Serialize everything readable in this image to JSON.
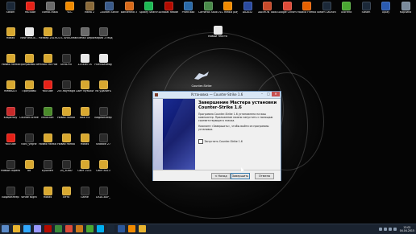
{
  "desktop": {
    "icons": [
      {
        "label": "Steam",
        "color": "#1b2838"
      },
      {
        "label": "YouTube",
        "color": "#e62117"
      },
      {
        "label": "combi-rasta",
        "color": "#6a6a6a"
      },
      {
        "label": "VLC",
        "color": "#f08a00"
      },
      {
        "label": "Mafia 2",
        "color": "#8a6a3a"
      },
      {
        "label": "Counter-Strike Global Offe...",
        "color": "#3a5a8a"
      },
      {
        "label": "Battlefield 3",
        "color": "#d86a1a"
      },
      {
        "label": "Spotify Search",
        "color": "#1db954"
      },
      {
        "label": "Acrobat Reader 5.0",
        "color": "#b30b00"
      },
      {
        "label": "ProfitTask",
        "color": "#2a6aa8"
      },
      {
        "label": "Cameras Studio 8",
        "color": "#4a8a4a"
      },
      {
        "label": "VLC media player",
        "color": "#f08a00"
      },
      {
        "label": "AIDA32",
        "color": "#2a4aa0"
      },
      {
        "label": "DAEMON Tools Lite",
        "color": "#c84a2a"
      },
      {
        "label": "Google Chrome",
        "color": "#dd4b39"
      },
      {
        "label": "Mozilla Firefox",
        "color": "#e66000"
      },
      {
        "label": "Steam Launcher",
        "color": "#1b2838"
      },
      {
        "label": "uTorrent",
        "color": "#4aa832"
      },
      {
        "label": "Steam",
        "color": "#1b2838"
      },
      {
        "label": "Uplay",
        "color": "#2a5ab0"
      },
      {
        "label": "Корзина",
        "color": "#7a8a9a"
      }
    ],
    "left_icons": [
      {
        "label": "Новая",
        "color": "#d8a830"
      },
      {
        "label": "New text-d...",
        "color": "#e8e8e8"
      },
      {
        "label": "Размер 2019",
        "color": "#d8a830"
      },
      {
        "label": "CSTL AntiCheat",
        "color": "#4a4a4a"
      },
      {
        "label": "Sniehail Depo",
        "color": "#6a6a6a"
      },
      {
        "label": "Мафия 2 Мод",
        "color": "#4a4a4a"
      },
      {
        "label": "Новая папка",
        "color": "#d8a830"
      },
      {
        "label": "Программы отложенные",
        "color": "#d8a830"
      },
      {
        "label": "Релакс на Новые",
        "color": "#d8a830"
      },
      {
        "label": "Ultra-Pix",
        "color": "#2a2a2a"
      },
      {
        "label": "1234WTTA",
        "color": "#e8e8e8"
      },
      {
        "label": "H4M4Dl0ebg",
        "color": "#e8e8e8"
      },
      {
        "label": "filed6023",
        "color": "#d8a830"
      },
      {
        "label": "Програмы",
        "color": "#d8a830"
      },
      {
        "label": "YouTube",
        "color": "#e62117"
      },
      {
        "label": "2cc.RayMagit",
        "color": "#2a2a2a"
      },
      {
        "label": "Сайт музыки",
        "color": "#d8a830"
      },
      {
        "label": "на удалить",
        "color": "#d8a830"
      },
      {
        "label": "Kaspersky",
        "color": "#c82a2a"
      },
      {
        "label": "Counter-Strike",
        "color": "#2a2a2a"
      },
      {
        "label": "Minecraft",
        "color": "#4a8a2a"
      },
      {
        "label": "Новая папка",
        "color": "#d8a830"
      },
      {
        "label": "Take Fix",
        "color": "#d8a830"
      },
      {
        "label": "Видеоплеер",
        "color": "#2a2a2a"
      },
      {
        "label": "YouTube",
        "color": "#e62117"
      },
      {
        "label": "tactl_yegne",
        "color": "#2a2a2a"
      },
      {
        "label": "Новая папка",
        "color": "#d8a830"
      },
      {
        "label": "Новая папка",
        "color": "#d8a830"
      },
      {
        "label": "Новая",
        "color": "#d8a830"
      },
      {
        "label": "Shadow 27",
        "color": "#2a2a2a"
      },
      {
        "label": "Новый скриншот",
        "color": "#2a2a2a"
      },
      {
        "label": "dd",
        "color": "#d8a830"
      },
      {
        "label": "Бушмен",
        "color": "#2a2a2a"
      },
      {
        "label": "2d_3D8D",
        "color": "#2a2a2a"
      },
      {
        "label": "Сайт 2021",
        "color": "#d8a830"
      },
      {
        "label": "Сайт 8013",
        "color": "#d8a830"
      },
      {
        "label": "Видеоплеер",
        "color": "#2a2a2a"
      },
      {
        "label": "White Night",
        "color": "#2a2a2a"
      },
      {
        "label": "Новая",
        "color": "#d8a830"
      },
      {
        "label": "Лето",
        "color": "#d8a830"
      },
      {
        "label": "Game",
        "color": "#2a2a2a"
      },
      {
        "label": "DSDCBUP_",
        "color": "#2a2a2a"
      }
    ],
    "misc_icon": {
      "label": "Новый текстовый",
      "color": "#e8e8e8"
    },
    "cs_logo_label": "Counter-Strike"
  },
  "installer": {
    "window_title": "Установка — Counter-Strike 1.6",
    "heading": "Завершение Мастера установки Counter-Strike 1.6",
    "body": "Программа Counter-Strike 1.6 установлена на ваш компьютер. Приложение можно запустить с помощью соответствующего значка.",
    "instruction": "Нажмите «Завершить», чтобы выйти из программы установки.",
    "checkbox_label": "Запустить Counter-Strike 1.6",
    "checkbox_checked": false,
    "back_button": "< Назад",
    "finish_button": "Завершить",
    "cancel_button": "Отмена"
  },
  "taskbar": {
    "apps": [
      {
        "name": "explorer-icon",
        "color": "#e8b430"
      },
      {
        "name": "photoshop-icon",
        "color": "#31a8ff"
      },
      {
        "name": "premiere-icon",
        "color": "#9999ff"
      },
      {
        "name": "acrobat-icon",
        "color": "#b30b00"
      },
      {
        "name": "media-icon",
        "color": "#3a8a3a"
      },
      {
        "name": "chrome-icon",
        "color": "#dd4b39"
      },
      {
        "name": "cs-icon",
        "color": "#cc7a1a"
      },
      {
        "name": "utorrent-icon",
        "color": "#4aa832"
      },
      {
        "name": "skype-icon",
        "color": "#00aff0"
      },
      {
        "name": "steam-icon",
        "color": "#1b2838"
      },
      {
        "name": "word-icon",
        "color": "#2b579a"
      },
      {
        "name": "vlc-icon",
        "color": "#f08a00"
      },
      {
        "name": "folder-icon",
        "color": "#e8b430"
      }
    ],
    "time": "13:02",
    "date": "04.04.2015"
  }
}
